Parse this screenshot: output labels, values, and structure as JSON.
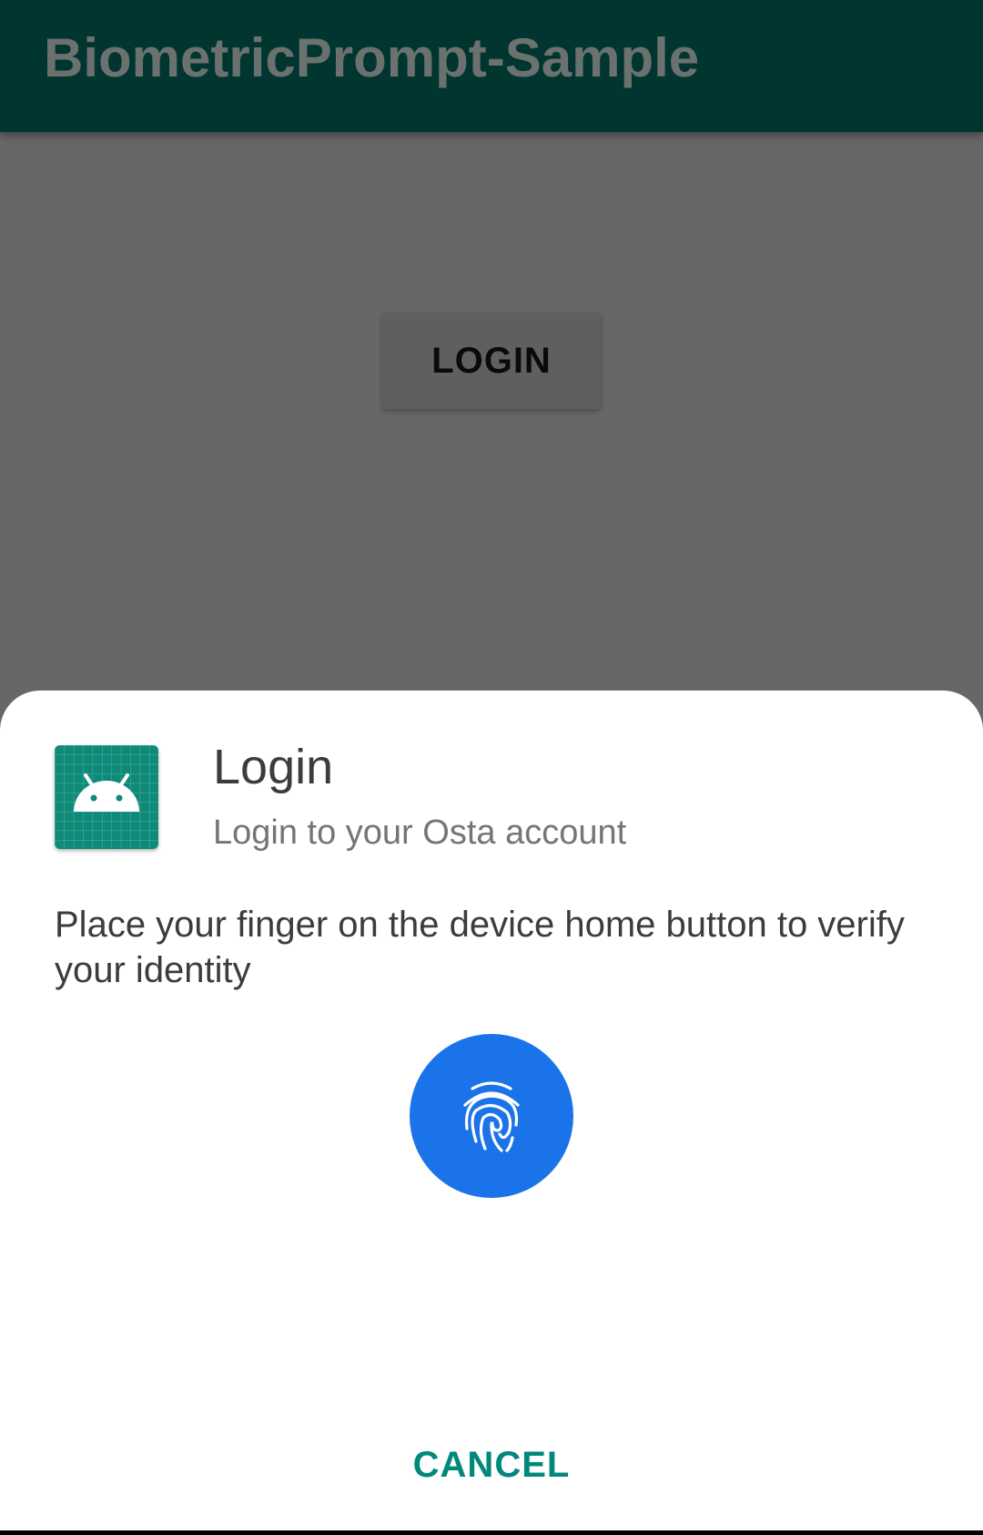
{
  "app_bar": {
    "title": "BiometricPrompt-Sample"
  },
  "main": {
    "login_button_label": "LOGIN"
  },
  "biometric_dialog": {
    "app_icon": "android-app-icon",
    "title": "Login",
    "subtitle": "Login to your Osta account",
    "description": "Place your finger on the device home button to verify your identity",
    "fingerprint_icon": "fingerprint-icon",
    "fingerprint_color": "#1a73e8",
    "cancel_label": "CANCEL",
    "accent_color": "#00897b"
  }
}
